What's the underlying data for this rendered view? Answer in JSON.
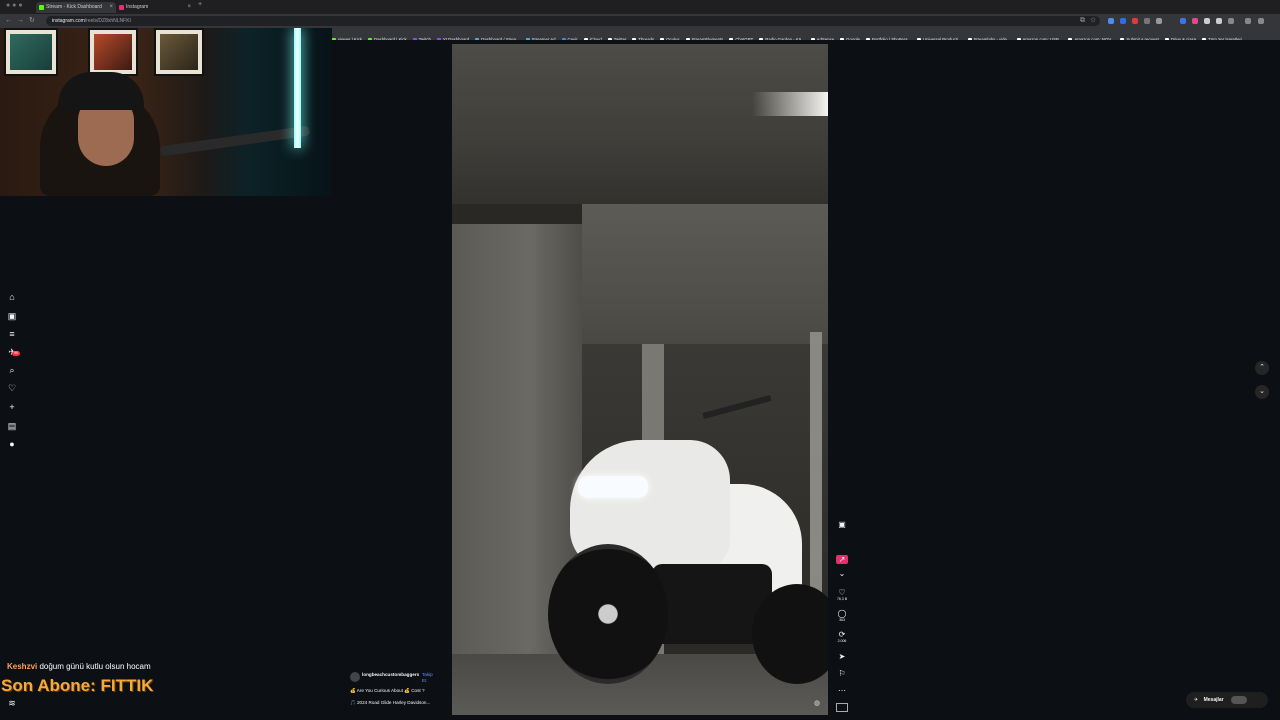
{
  "browser": {
    "tabs": [
      {
        "label": "Stream - Kick Dashboard",
        "color": "#53fc18"
      },
      {
        "label": "Instagram",
        "color": "#e1306c"
      }
    ],
    "url": {
      "domain": "instagram.com",
      "path": "/reels/DZ8xhNLNFKI"
    },
    "bookmarks": [
      {
        "label": "viewer | Kick",
        "color": "#53fc18"
      },
      {
        "label": "Dashboard | Kick",
        "color": "#53fc18"
      },
      {
        "label": "Twitch",
        "color": "#9146ff"
      },
      {
        "label": "Yt Dashboard",
        "color": "#9146ff"
      },
      {
        "label": "Dashboard / Strea...",
        "color": "#3bb3e8"
      },
      {
        "label": "Streamer Ad",
        "color": "#3bb3e8"
      },
      {
        "label": "Çevir",
        "color": "#4285f4"
      },
      {
        "label": "iCloud",
        "color": "#ffffff"
      },
      {
        "label": "Twitter",
        "color": "#ffffff"
      },
      {
        "label": "Threads",
        "color": "#ffffff"
      },
      {
        "label": "Oculus",
        "color": "#ffffff"
      },
      {
        "label": "StreamElements",
        "color": "#ffffff"
      },
      {
        "label": "ChatGPT",
        "color": "#ffffff"
      },
      {
        "label": "Radio Garden - Kä...",
        "color": "#ffffff"
      },
      {
        "label": "AdSense",
        "color": "#ffffff"
      },
      {
        "label": "Google",
        "color": "#ffffff"
      },
      {
        "label": "Portfolio | Shuttera...",
        "color": "#ffffff"
      },
      {
        "label": "Universal Producti...",
        "color": "#ffffff"
      },
      {
        "label": "Streamlabs - vide...",
        "color": "#ffffff"
      },
      {
        "label": "Amazon.com: USB...",
        "color": "#ffffff"
      },
      {
        "label": "Amazon.com: NOV...",
        "color": "#ffffff"
      },
      {
        "label": "Submit a request",
        "color": "#ffffff"
      },
      {
        "label": "Drive & ciasa",
        "color": "#ffffff"
      },
      {
        "label": "Tüm Yer İşaretleri",
        "color": "#ffffff"
      }
    ]
  },
  "sidebar": {
    "items": [
      {
        "name": "home",
        "glyph": "⌂"
      },
      {
        "name": "reels",
        "glyph": "▣"
      },
      {
        "name": "menu",
        "glyph": "≡"
      },
      {
        "name": "messages",
        "glyph": "✈",
        "badge": "90"
      },
      {
        "name": "search",
        "glyph": "⌕"
      },
      {
        "name": "notifications",
        "glyph": "♡"
      },
      {
        "name": "create",
        "glyph": "+"
      },
      {
        "name": "dashboard",
        "glyph": "▤"
      },
      {
        "name": "profile",
        "glyph": "●"
      },
      {
        "name": "more",
        "glyph": "≋"
      }
    ]
  },
  "reel": {
    "author": "longbeachcustombaggers",
    "follow_label": "Takip Et",
    "caption_line1": "💰 Are You Curious About 💰 Cost ?",
    "caption_line2": "🎵 2024 Road Glide Harley Davidson...",
    "actions": {
      "likes": "76,3 B",
      "comments": "363",
      "reposts": "2.006"
    }
  },
  "messages_label": "Mesajlar",
  "overlay": {
    "chat_user": "Keshzvi",
    "chat_text": " doğum günü kutlu olsun hocam",
    "latest_sub": "Son Abone: FITTIK"
  }
}
